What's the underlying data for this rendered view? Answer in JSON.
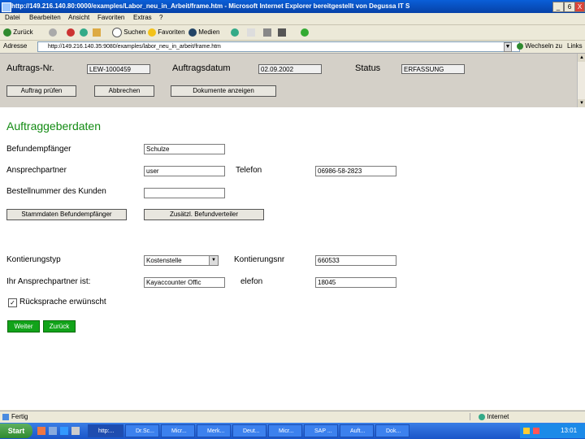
{
  "window": {
    "title": "http://149.216.140.80:0000/examples/Labor_neu_in_Arbeit/frame.htm - Microsoft Internet Explorer bereitgestellt von Degussa IT S",
    "controls": [
      "_",
      "6",
      "X"
    ]
  },
  "menu": [
    "Datei",
    "Bearbeiten",
    "Ansicht",
    "Favoriten",
    "Extras",
    "?"
  ],
  "toolbar": {
    "back": "Zurück",
    "search": "Suchen",
    "favorites": "Favoriten",
    "media": "Medien"
  },
  "address": {
    "label": "Adresse",
    "url": "http://149.216.140.35:9080/examples/labor_neu_in_arbeit/frame.htm",
    "go": "Wechseln zu",
    "links": "Links"
  },
  "header": {
    "order_no_label": "Auftrags-Nr.",
    "order_no_value": "LEW-1000459",
    "order_date_label": "Auftragsdatum",
    "order_date_value": "02.09.2002",
    "status_label": "Status",
    "status_value": "ERFASSUNG",
    "buttons": {
      "complete": "Auftrag prüfen",
      "cancel": "Abbrechen",
      "documents": "Dokumente anzeigen"
    }
  },
  "form": {
    "section_title": "Auftraggeberdaten",
    "recipient_label": "Befundempfänger",
    "recipient_value": "Schulze",
    "contact_label": "Ansprechpartner",
    "contact_value": "user",
    "phone_label": "Telefon",
    "phone_value": "06986-58-2823",
    "customer_order_label": "Bestellnummer des Kunden",
    "customer_order_value": "",
    "btn_master_recipient": "Stammdaten Befundempfänger",
    "btn_extra_distribution": "Zusätzl. Befundverteiler",
    "account_type_label": "Kontierungstyp",
    "account_type_value": "Kostenstelle",
    "account_no_label": "Kontierungsnr",
    "account_no_value": "660533",
    "your_contact_label": "Ihr Ansprechpartner ist:",
    "your_contact_value": "Kayaccounter Offic",
    "phone2_label": "elefon",
    "phone2_value": "18045",
    "callback_label": "Rücksprache erwünscht",
    "btn_next": "Weiter",
    "btn_back": "Zurück"
  },
  "status_bar": {
    "left": "Fertig",
    "zone": "Internet"
  },
  "taskbar": {
    "start": "Start",
    "tasks": [
      "http:...",
      "Dr.Sc...",
      "Micr...",
      "Merk...",
      "Deut...",
      "Micr...",
      "SAP ...",
      "Auft...",
      "Dok..."
    ],
    "clock": "13:01"
  },
  "colors": {
    "section_green": "#138b13",
    "button_green": "#12a31a"
  }
}
